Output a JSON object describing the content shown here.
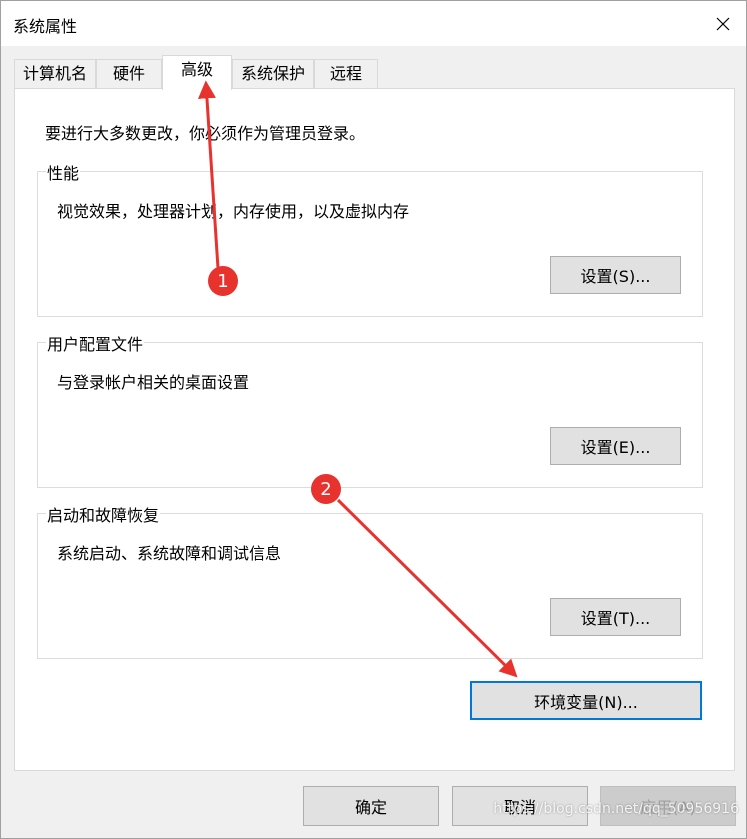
{
  "window": {
    "title": "系统属性",
    "close_icon": "close-icon"
  },
  "tabs": [
    {
      "label": "计算机名",
      "active": false
    },
    {
      "label": "硬件",
      "active": false
    },
    {
      "label": "高级",
      "active": true
    },
    {
      "label": "系统保护",
      "active": false
    },
    {
      "label": "远程",
      "active": false
    }
  ],
  "advanced": {
    "intro": "要进行大多数更改，你必须作为管理员登录。",
    "performance": {
      "title": "性能",
      "description": "视觉效果，处理器计划，内存使用，以及虚拟内存",
      "button": "设置(S)..."
    },
    "user_profiles": {
      "title": "用户配置文件",
      "description": "与登录帐户相关的桌面设置",
      "button": "设置(E)..."
    },
    "startup_recovery": {
      "title": "启动和故障恢复",
      "description": "系统启动、系统故障和调试信息",
      "button": "设置(T)..."
    },
    "env_button": "环境变量(N)..."
  },
  "footer": {
    "ok": "确定",
    "cancel": "取消",
    "apply": "应用(A)"
  },
  "annotations": {
    "callout_1": "1",
    "callout_2": "2",
    "color": "#e8322e"
  },
  "watermark": "https://blog.csdn.net/qq_50956916"
}
